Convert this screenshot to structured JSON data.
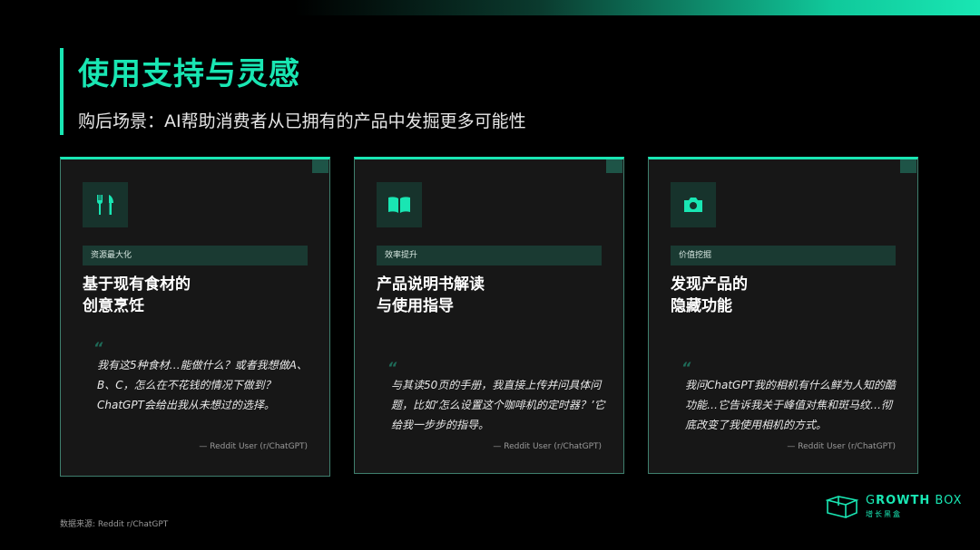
{
  "header": {
    "title": "使用支持与灵感",
    "subtitle": "购后场景：AI帮助消费者从已拥有的产品中发掘更多可能性"
  },
  "cards": [
    {
      "icon": "fork-knife-icon",
      "tag": "资源最大化",
      "heading_line1": "基于现有食材的",
      "heading_line2": "创意烹饪",
      "quote_mark": "“",
      "quote": "我有这5种食材…能做什么？或者我想做A、B、C，怎么在不花钱的情况下做到？ChatGPT会给出我从未想过的选择。",
      "source": "— Reddit User (r/ChatGPT)"
    },
    {
      "icon": "open-book-icon",
      "tag": "效率提升",
      "heading_line1": "产品说明书解读",
      "heading_line2": "与使用指导",
      "quote_mark": "“",
      "quote": "与其读50页的手册，我直接上传并问具体问题，比如‘怎么设置这个咖啡机的定时器？’它给我一步步的指导。",
      "source": "— Reddit User (r/ChatGPT)"
    },
    {
      "icon": "camera-icon",
      "tag": "价值挖掘",
      "heading_line1": "发现产品的",
      "heading_line2": "隐藏功能",
      "quote_mark": "“",
      "quote": "我问ChatGPT我的相机有什么鲜为人知的酷功能…它告诉我关于峰值对焦和斑马纹…彻底改变了我使用相机的方式。",
      "source": "— Reddit User (r/ChatGPT)"
    }
  ],
  "footer": {
    "note": "数据来源: Reddit r/ChatGPT",
    "logo_en_light": "G",
    "logo_en_rest": "ROWTH",
    "logo_en_box": "BOX",
    "logo_cn": "增长黑盒"
  },
  "colors": {
    "accent": "#19e6b3",
    "card_bg": "#171717",
    "tag_bg": "#1a3a32"
  }
}
